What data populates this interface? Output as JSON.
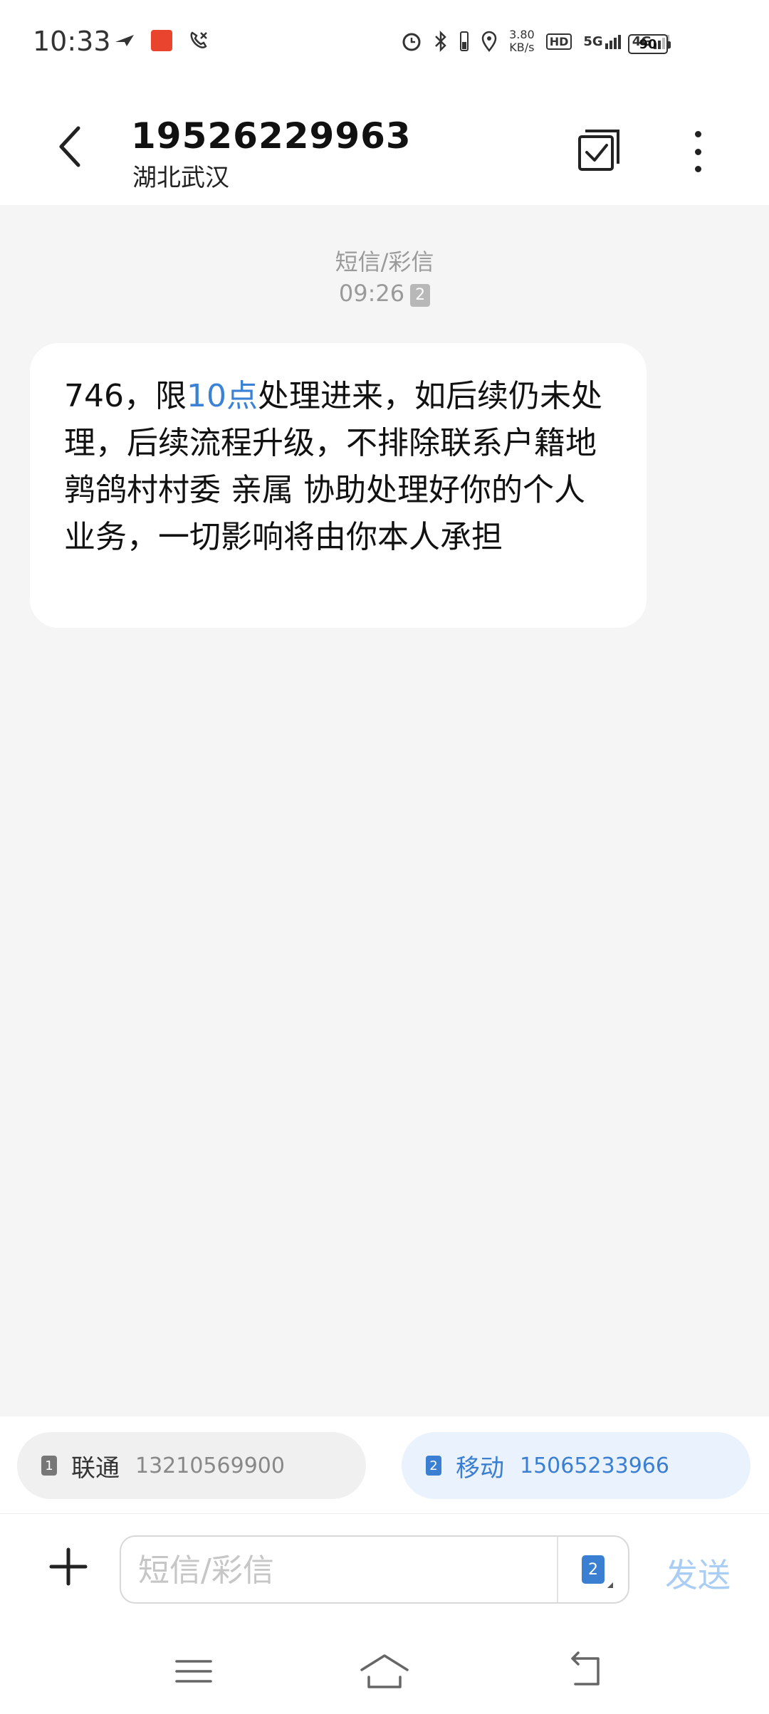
{
  "status_bar": {
    "time": "10:33",
    "net_speed_value": "3.80",
    "net_speed_unit": "KB/s",
    "hd_label": "HD",
    "network_1": "5G",
    "network_2": "4G",
    "battery": "90"
  },
  "header": {
    "contact_number": "19526229963",
    "contact_location": "湖北武汉"
  },
  "conversation": {
    "message_type": "短信/彩信",
    "time": "09:26",
    "sim_tag": "2",
    "message": {
      "part1": "746，限",
      "highlight": "10点",
      "part2": "处理进来，如后续仍未处理，后续流程升级，不排除联系户籍地鹑鸽村村委 亲属 协助处理好你的个人业务，一切影响将由你本人承担"
    }
  },
  "sim_selector": {
    "sim1": {
      "tag": "1",
      "carrier": "联通",
      "number": "13210569900"
    },
    "sim2": {
      "tag": "2",
      "carrier": "移动",
      "number": "15065233966"
    }
  },
  "composer": {
    "placeholder": "短信/彩信",
    "sim_tag": "2",
    "send_label": "发送"
  },
  "colors": {
    "accent": "#3a7fd2",
    "send_disabled": "#a9cdf3",
    "background": "#f5f5f5"
  }
}
